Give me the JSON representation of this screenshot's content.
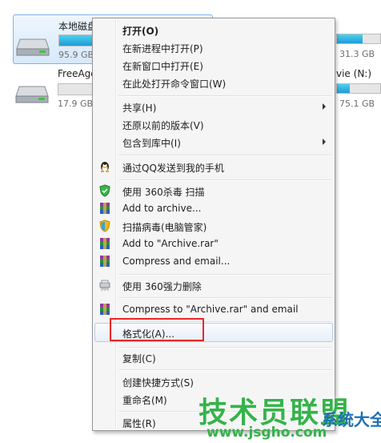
{
  "drives": [
    {
      "name": "本地磁盘",
      "size": "95.9 GB",
      "used_fraction": 0.55,
      "selected": true
    },
    {
      "name": "FreeAge",
      "size": "17.9 GB",
      "used_fraction": 0.0,
      "selected": false
    },
    {
      "name": "",
      "size": "31.3 GB",
      "used_fraction": 0.4,
      "selected": false
    },
    {
      "name": "vie (N:)",
      "size": "75.1 GB",
      "used_fraction": 0.3,
      "selected": false
    }
  ],
  "menu": {
    "open": "打开(O)",
    "open_new_process": "在新进程中打开(P)",
    "open_new_window": "在新窗口中打开(E)",
    "open_cmd_here": "在此处打开命令窗口(W)",
    "share": "共享(H)",
    "restore_previous": "还原以前的版本(V)",
    "include_in_library": "包含到库中(I)",
    "send_qq_phone": "通过QQ发送到我的手机",
    "scan_360": "使用 360杀毒 扫描",
    "add_to_archive": "Add to archive...",
    "scan_pc_manager": "扫描病毒(电脑管家)",
    "add_to_archive_rar": "Add to \"Archive.rar\"",
    "compress_email": "Compress and email...",
    "force_delete_360": "使用 360强力删除",
    "compress_rar_email": "Compress to \"Archive.rar\" and email",
    "format": "格式化(A)...",
    "copy": "复制(C)",
    "create_shortcut": "创建快捷方式(S)",
    "rename": "重命名(M)",
    "properties": "属性(R)"
  },
  "watermark": {
    "title": "技术员联盟",
    "subtitle": "www.jsgho.com",
    "side": "系统大全"
  },
  "colors": {
    "highlight_box": "#e8272a",
    "drive_bar": "#1e9bd7",
    "watermark_green": "#35b34a"
  }
}
